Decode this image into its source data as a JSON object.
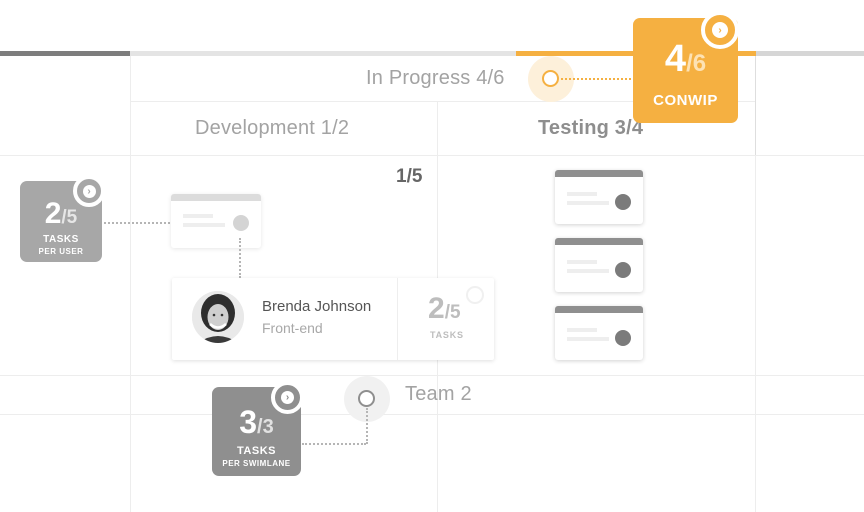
{
  "columns": {
    "in_progress": "In Progress 4/6",
    "development": "Development 1/2",
    "testing": "Testing 3/4"
  },
  "cell_limit": "1/5",
  "conwip": {
    "current": "4",
    "limit": "/6",
    "label": "CONWIP"
  },
  "per_user_limit": {
    "current": "2",
    "limit": "/5",
    "label": "TASKS",
    "sublabel": "PER USER"
  },
  "per_swimlane_limit": {
    "current": "3",
    "limit": "/3",
    "label": "TASKS",
    "sublabel": "PER SWIMLANE"
  },
  "user": {
    "name": "Brenda Johnson",
    "role": "Front-end",
    "limit_current": "2",
    "limit_max": "/5",
    "limit_label": "TASKS"
  },
  "swimlane": {
    "name": "Team 2"
  },
  "colors": {
    "accent": "#f5b041",
    "card_gray": "#a7a7a7",
    "dark_gray": "#8f8f8f"
  }
}
